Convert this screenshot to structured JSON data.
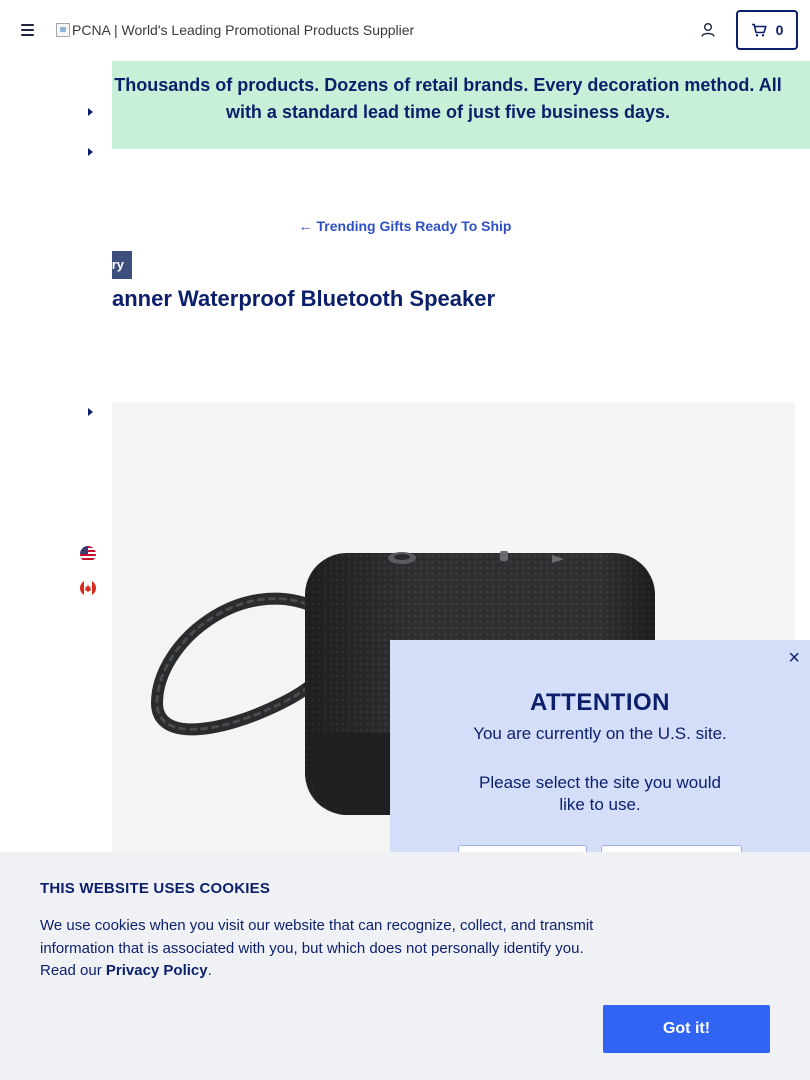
{
  "header": {
    "logo_alt": "PCNA | World's Leading Promotional Products Supplier",
    "cart_count": "0"
  },
  "promo": {
    "text_line1": "Thousands of products. Dozens of retail brands. Every decoration method. All",
    "text_line2": "with a standard lead time of just five business days."
  },
  "breadcrumb": {
    "back_label": "Trending Gifts Ready To Ship"
  },
  "product": {
    "category_tag": "ry",
    "title": "anner Waterproof Bluetooth Speaker"
  },
  "site_modal": {
    "title": "ATTENTION",
    "current_site": "You are currently on the U.S. site.",
    "prompt": "Please select the site you would like to use.",
    "close_symbol": "×"
  },
  "cookie_banner": {
    "title": "THIS WEBSITE USES COOKIES",
    "text_before_link": "We use cookies when you visit our website that can recognize, collect, and transmit information that is associated with you, but which does not personally identify you. Read our ",
    "link_label": "Privacy Policy",
    "text_after_link": ".",
    "accept_label": "Got it!"
  },
  "icons": {
    "menu": "hamburger-icon",
    "account": "user-icon",
    "cart": "cart-icon",
    "back": "arrow-left-icon",
    "flags": [
      "us-flag-icon",
      "canada-flag-icon"
    ]
  },
  "colors": {
    "brand_navy": "#0b1f6b",
    "promo_bg": "#c8f0d8",
    "link_blue": "#2f50c4",
    "modal_bg": "#d4def8",
    "button_blue": "#2f65f2"
  }
}
